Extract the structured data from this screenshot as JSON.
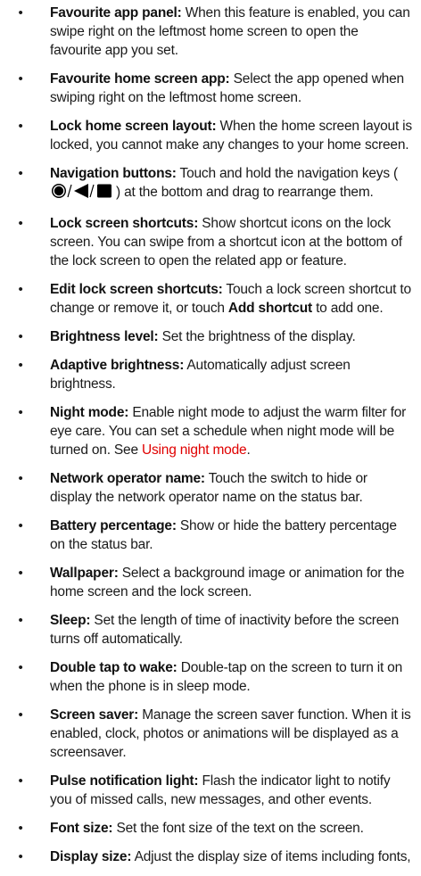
{
  "items": [
    {
      "id": "favourite-app-panel",
      "term": "Favourite app panel:",
      "text": " When this feature is enabled, you can swipe right on the leftmost home screen to open the favourite app you set."
    },
    {
      "id": "favourite-home-screen-app",
      "term": "Favourite home screen app:",
      "text": " Select the app opened when swiping right on the leftmost home screen."
    },
    {
      "id": "lock-home-screen-layout",
      "term": "Lock home screen layout:",
      "text": " When the home screen layout is locked, you cannot make any changes to your home screen."
    },
    {
      "id": "navigation-buttons",
      "term": "Navigation buttons:",
      "text_before": " Touch and hold the navigation keys (",
      "text_after": ") at the bottom and drag to rearrange them.",
      "icons": [
        "home-circle-icon",
        "back-triangle-icon",
        "recent-square-icon"
      ]
    },
    {
      "id": "lock-screen-shortcuts",
      "term": "Lock screen shortcuts:",
      "text": " Show shortcut icons on the lock screen. You can swipe from a shortcut icon at the bottom of the lock screen to open the related app or feature."
    },
    {
      "id": "edit-lock-screen-shortcuts",
      "term": "Edit lock screen shortcuts:",
      "text_before": " Touch a lock screen shortcut to change or remove it, or touch ",
      "bold": "Add shortcut",
      "text_after": " to add one."
    },
    {
      "id": "brightness-level",
      "term": "Brightness level:",
      "text": " Set the brightness of the display."
    },
    {
      "id": "adaptive-brightness",
      "term": "Adaptive brightness:",
      "text": " Automatically adjust screen brightness."
    },
    {
      "id": "night-mode",
      "term": "Night mode:",
      "text_before": " Enable night mode to adjust the warm filter for eye care. You can set a schedule when night mode will be turned on. See ",
      "link": "Using night mode",
      "text_after": "."
    },
    {
      "id": "network-operator-name",
      "term": "Network operator name:",
      "text": " Touch the switch to hide or display the network operator name on the status bar."
    },
    {
      "id": "battery-percentage",
      "term": "Battery percentage:",
      "text": " Show or hide the battery percentage on the status bar."
    },
    {
      "id": "wallpaper",
      "term": "Wallpaper:",
      "text": " Select a background image or animation for the home screen and the lock screen."
    },
    {
      "id": "sleep",
      "term": "Sleep:",
      "text": " Set the length of time of inactivity before the screen turns off automatically."
    },
    {
      "id": "double-tap-to-wake",
      "term": "Double tap to wake:",
      "text": " Double-tap on the screen to turn it on when the phone is in sleep mode."
    },
    {
      "id": "screen-saver",
      "term": "Screen saver:",
      "text": " Manage the screen saver function. When it is enabled, clock, photos or animations will be displayed as a screensaver."
    },
    {
      "id": "pulse-notification-light",
      "term": "Pulse notification light:",
      "text": " Flash the indicator light to notify you of missed calls, new messages, and other events."
    },
    {
      "id": "font-size",
      "term": "Font size:",
      "text": " Set the font size of the text on the screen."
    },
    {
      "id": "display-size",
      "term": "Display size:",
      "text": " Adjust the display size of items including fonts,"
    }
  ],
  "bullet_glyph": "•",
  "colors": {
    "link": "#e00000",
    "text": "#1a1a1a"
  }
}
